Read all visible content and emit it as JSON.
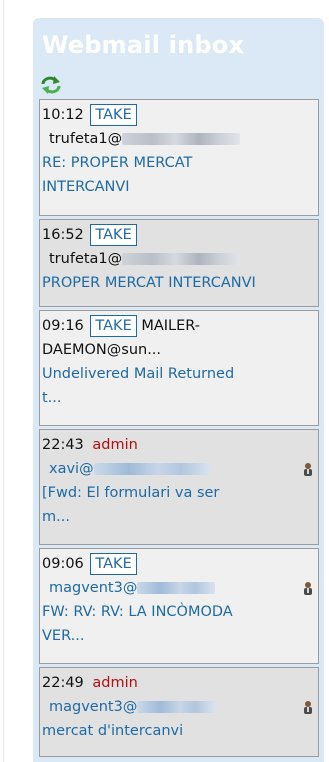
{
  "inbox": {
    "title": "Webmail inbox",
    "refresh_icon": "refresh-icon",
    "take_label": "TAKE",
    "items": [
      {
        "time": "10:12",
        "take": true,
        "owner": "",
        "from": "trufeta1@",
        "subject_1": "RE: PROPER MERCAT",
        "subject_2": "INTERCANVI"
      },
      {
        "time": "16:52",
        "take": true,
        "owner": "",
        "from": "trufeta1@",
        "subject_1": "PROPER MERCAT INTERCANVI",
        "subject_2": ""
      },
      {
        "time": "09:16",
        "take": true,
        "owner": "",
        "from_1": "MAILER-",
        "from_2": "DAEMON@sun...",
        "subject_1": "Undelivered Mail Returned",
        "subject_2": "t..."
      },
      {
        "time": "22:43",
        "take": false,
        "owner": "admin",
        "from": "xavi@",
        "subject_1": "[Fwd: El formulari va ser",
        "subject_2": "m..."
      },
      {
        "time": "09:06",
        "take": true,
        "owner": "",
        "from": "magvent3@",
        "subject_1": "FW: RV: RV: LA INCÒMODA",
        "subject_2": "VER..."
      },
      {
        "time": "22:49",
        "take": false,
        "owner": "admin",
        "from": "magvent3@",
        "subject_1": "mercat d'intercanvi",
        "subject_2": ""
      }
    ]
  }
}
